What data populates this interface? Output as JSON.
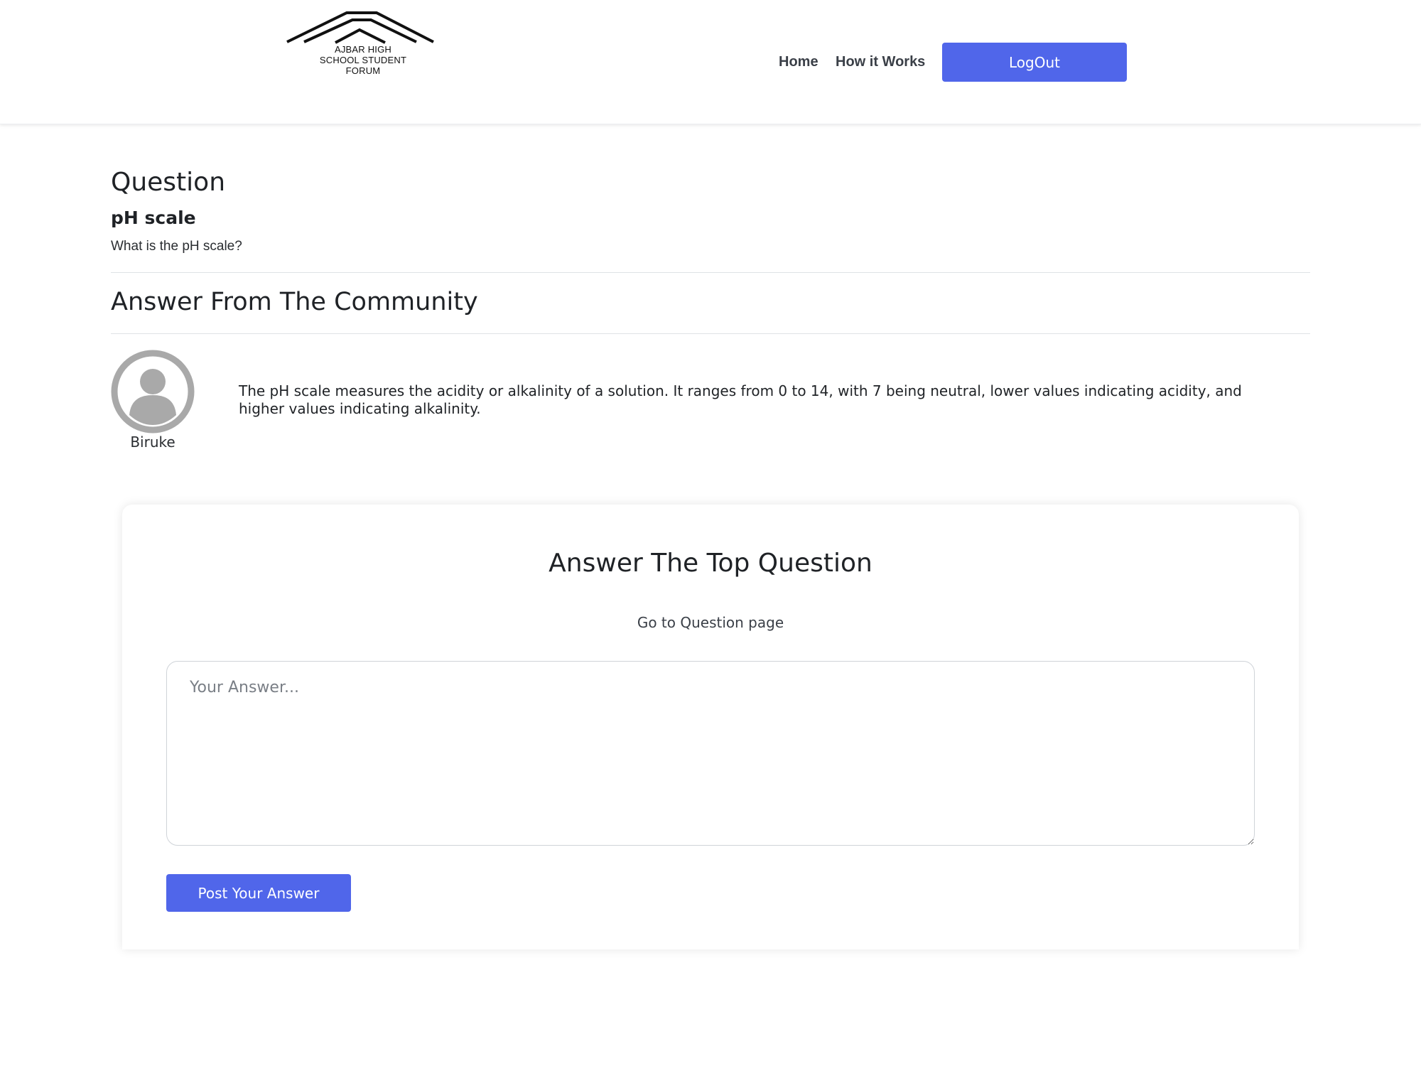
{
  "header": {
    "logo": {
      "lines": [
        "AJBAR HIGH",
        "SCHOOL STUDENT",
        "FORUM"
      ]
    },
    "nav": {
      "home": "Home",
      "how_it_works": "How it Works"
    },
    "logout_label": "LogOut",
    "accent_color": "#5066ea"
  },
  "question": {
    "heading": "Question",
    "title": "pH scale",
    "body": "What is the pH scale?"
  },
  "answers": {
    "heading": "Answer From The Community",
    "items": [
      {
        "author": "Biruke",
        "avatar_icon": "user-avatar-icon",
        "text": "The pH scale measures the acidity or alkalinity of a solution. It ranges from 0 to 14, with 7 being neutral, lower values indicating acidity, and higher values indicating alkalinity."
      }
    ]
  },
  "answer_form": {
    "title": "Answer The Top Question",
    "link_label": "Go to Question page",
    "placeholder": "Your Answer...",
    "submit_label": "Post Your Answer"
  }
}
